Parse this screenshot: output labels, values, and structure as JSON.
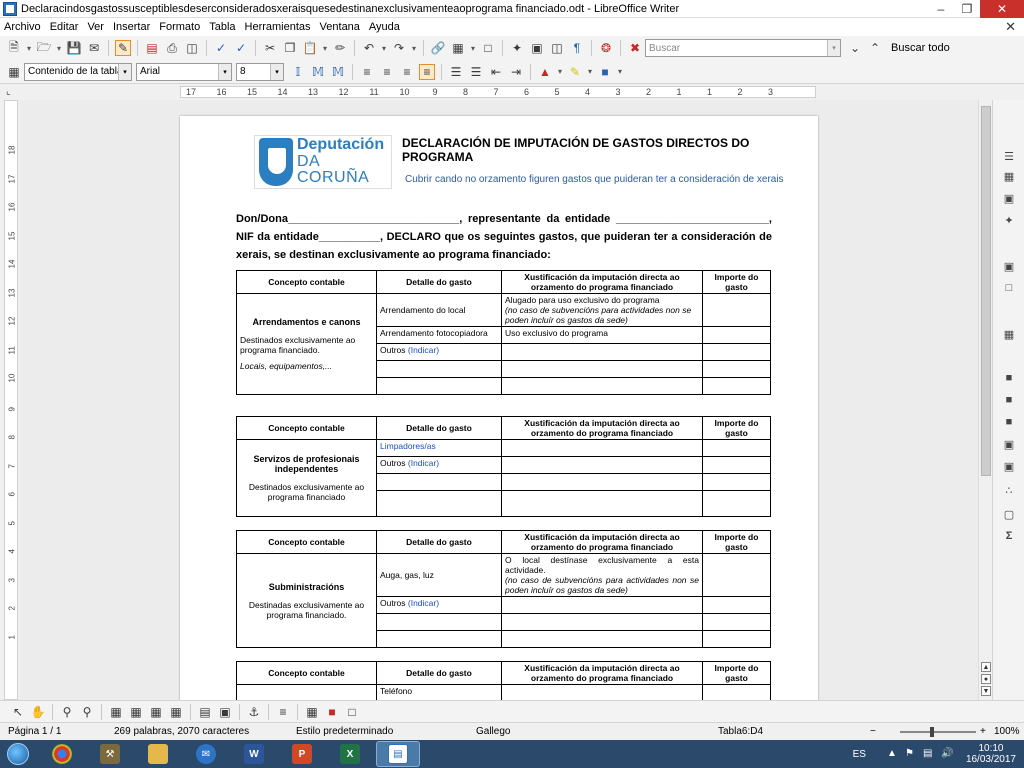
{
  "window": {
    "title": "Declaracindosgastossusceptiblesdeserconsideradosxeraisquesedestinanexclusivamenteaoprograma financiado.odt - LibreOffice Writer"
  },
  "menu": [
    "Archivo",
    "Editar",
    "Ver",
    "Insertar",
    "Formato",
    "Tabla",
    "Herramientas",
    "Ventana",
    "Ayuda"
  ],
  "toolbar": {
    "search_placeholder": "Buscar",
    "find_all": "Buscar todo",
    "paragraph_style": "Contenido de la tabla",
    "font_name": "Arial",
    "font_size": "8"
  },
  "ruler": {
    "ticks": [
      "17",
      "16",
      "15",
      "14",
      "13",
      "12",
      "11",
      "10",
      "9",
      "8",
      "7",
      "6",
      "5",
      "4",
      "3",
      "2",
      "1",
      "1",
      "2",
      "3"
    ],
    "vticks": [
      "18",
      "17",
      "16",
      "15",
      "14",
      "13",
      "12",
      "11",
      "10",
      "9",
      "8",
      "7",
      "6",
      "5",
      "4",
      "3",
      "2",
      "1"
    ]
  },
  "document": {
    "logo_line1": "Deputación",
    "logo_line2": "DA CORUÑA",
    "title": "DECLARACIÓN DE IMPUTACIÓN DE GASTOS DIRECTOS DO PROGRAMA",
    "subtitle": "Cubrir cando no orzamento figuren gastos que puideran ter a consideración de xerais",
    "intro": "Don/Dona____________________________, representante da entidade _________________________, NIF da entidade__________, DECLARO que os seguintes gastos, que puideran ter a consideración de xerais, se destinan exclusivamente ao programa financiado:",
    "headers": {
      "concept": "Concepto contable",
      "detail": "Detalle do gasto",
      "justification": "Xustificación da imputación directa ao orzamento do programa financiado",
      "amount": "Importe do gasto"
    },
    "table1": {
      "category": "Arrendamentos e canons",
      "description": "Destinados exclusivamente ao programa financiado.",
      "example": "Locais, equipamentos,...",
      "row1_detail": "Arrendamento do local",
      "row1_just_a": "Alugado para uso exclusivo do programa",
      "row1_just_b": "(no caso de subvencións para actividades non se poden incluír os gastos da sede)",
      "row2_detail": "Arrendamento fotocopiadora",
      "row2_just": "Uso exclusivo do programa",
      "row3_detail_a": "Outros",
      "row3_detail_b": "(Indicar)"
    },
    "table2": {
      "category": "Servizos de profesionais independentes",
      "description": "Destinados exclusivamente ao programa financiado",
      "row1_detail": "Limpadores/as",
      "row2_detail_a": "Outros",
      "row2_detail_b": "(Indicar)"
    },
    "table3": {
      "category": "Subministracións",
      "description": "Destinadas exclusivamente ao programa financiado.",
      "row1_detail": "Auga, gas, luz",
      "row1_just_a": "O local destínase exclusivamente a esta actividade.",
      "row1_just_b": "(no caso de subvencións para actividades non se poden incluír os gastos da sede)",
      "row2_detail_a": "Outros",
      "row2_detail_b": "(Indicar)"
    },
    "table4": {
      "row1_detail": "Teléfono"
    }
  },
  "status": {
    "page": "Página 1 / 1",
    "words": "269 palabras, 2070 caracteres",
    "page_style": "Estilo predeterminado",
    "language": "Gallego",
    "cell": "Tabla6:D4",
    "zoom": "100%"
  },
  "taskbar": {
    "lang": "ES",
    "time": "10:10",
    "date": "16/03/2017"
  },
  "colors": {
    "brand_blue": "#2b7fc1",
    "link_blue": "#1f4ec1",
    "taskbar": "#2b4a6b"
  }
}
